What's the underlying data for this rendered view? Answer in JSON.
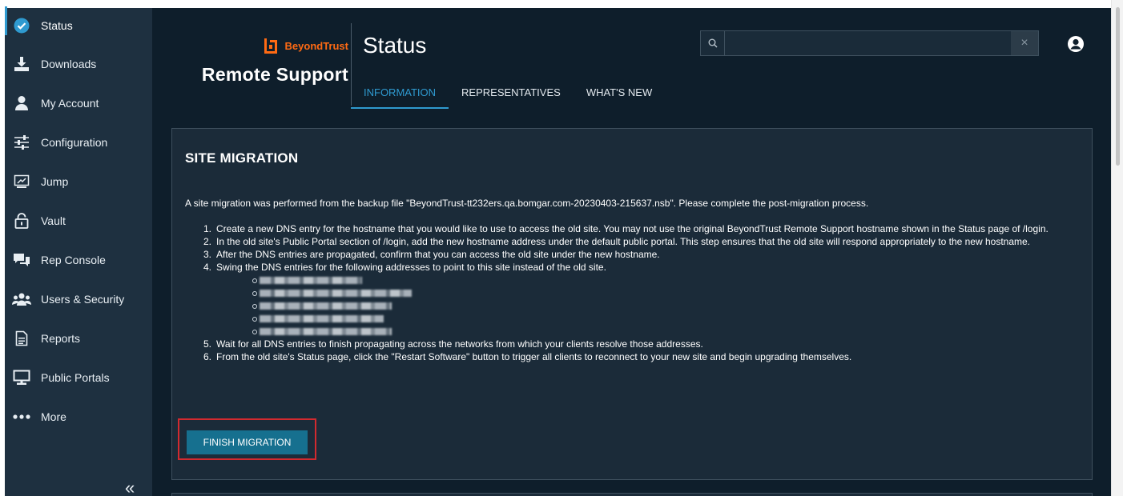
{
  "sidebar": {
    "items": [
      {
        "label": "Status",
        "icon": "check-circle-icon"
      },
      {
        "label": "Downloads",
        "icon": "download-icon"
      },
      {
        "label": "My Account",
        "icon": "user-icon"
      },
      {
        "label": "Configuration",
        "icon": "sliders-icon"
      },
      {
        "label": "Jump",
        "icon": "jump-icon"
      },
      {
        "label": "Vault",
        "icon": "lock-icon"
      },
      {
        "label": "Rep Console",
        "icon": "chat-bubbles-icon"
      },
      {
        "label": "Users & Security",
        "icon": "users-icon"
      },
      {
        "label": "Reports",
        "icon": "report-icon"
      },
      {
        "label": "Public Portals",
        "icon": "monitor-icon"
      },
      {
        "label": "More",
        "icon": "ellipsis-icon"
      }
    ],
    "active_index": 0,
    "collapse_glyph": "«"
  },
  "brand": {
    "company": "BeyondTrust",
    "product": "Remote Support"
  },
  "header": {
    "title": "Status",
    "tabs": [
      {
        "label": "INFORMATION",
        "active": true
      },
      {
        "label": "REPRESENTATIVES",
        "active": false
      },
      {
        "label": "WHAT'S NEW",
        "active": false
      }
    ],
    "search": {
      "value": "",
      "placeholder": "",
      "clear_glyph": "×"
    }
  },
  "migration": {
    "title": "SITE MIGRATION",
    "intro": "A site migration was performed from the backup file \"BeyondTrust-tt232ers.qa.bomgar.com-20230403-215637.nsb\". Please complete the post-migration process.",
    "steps": [
      "Create a new DNS entry for the hostname that you would like to use to access the old site. You may not use the original BeyondTrust Remote Support hostname shown in the Status page of /login.",
      "In the old site's Public Portal section of /login, add the new hostname address under the default public portal. This step ensures that the old site will respond appropriately to the new hostname.",
      "After the DNS entries are propagated, confirm that you can access the old site under the new hostname.",
      "Swing the DNS entries for the following addresses to point to this site instead of the old site.",
      "Wait for all DNS entries to finish propagating across the networks from which your clients resolve those addresses.",
      "From the old site's Status page, click the \"Restart Software\" button to trigger all clients to reconnect to your new site and begin upgrading themselves."
    ],
    "step_numbers": [
      "1.",
      "2.",
      "3.",
      "4.",
      "5.",
      "6."
    ],
    "redacted_address_count": 5,
    "finish_button": "FINISH MIGRATION"
  },
  "colors": {
    "sidebar_bg": "#1e3040",
    "main_bg": "#0e1e2b",
    "panel_bg": "#1b2b39",
    "accent": "#2f9ad0",
    "brand_orange": "#ff6a13",
    "button_bg": "#16708f",
    "highlight_border": "#d22a2f"
  }
}
